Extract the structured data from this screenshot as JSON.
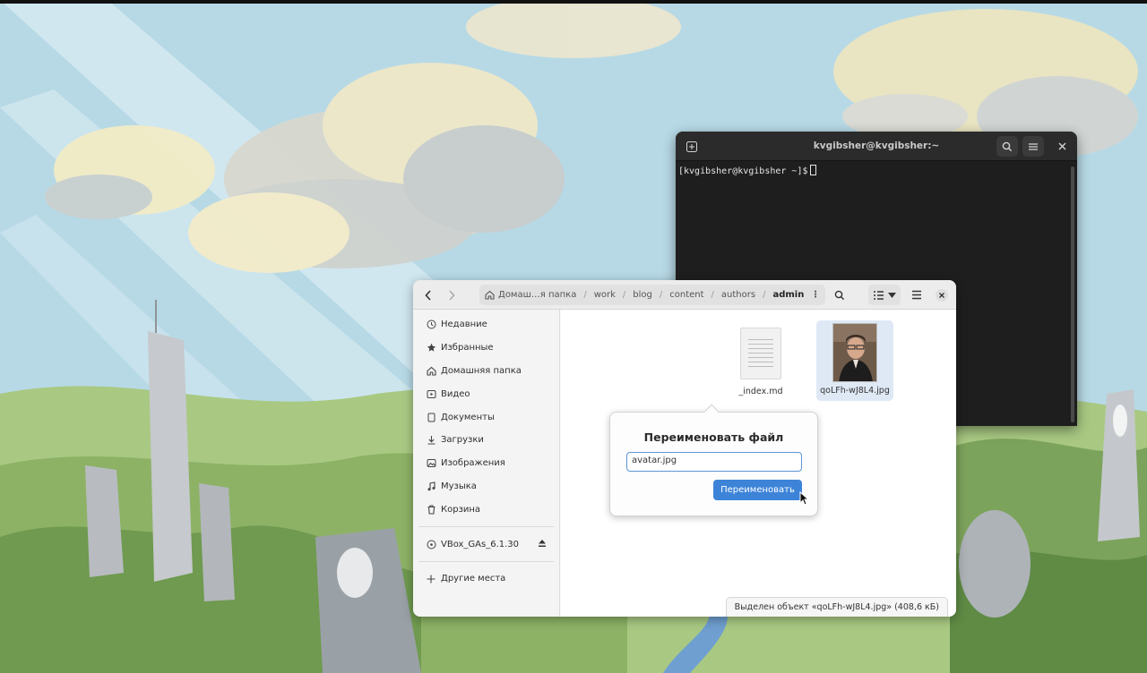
{
  "terminal": {
    "title": "kvgibsher@kvgibsher:~",
    "prompt": "[kvgibsher@kvgibsher ~]$"
  },
  "file_manager": {
    "breadcrumbs": [
      {
        "label": "Домаш…я папка",
        "icon": "home-icon"
      },
      {
        "label": "work"
      },
      {
        "label": "blog"
      },
      {
        "label": "content"
      },
      {
        "label": "authors"
      },
      {
        "label": "admin",
        "current": true
      }
    ],
    "sidebar": {
      "places": [
        {
          "label": "Недавние",
          "icon": "clock-icon"
        },
        {
          "label": "Избранные",
          "icon": "star-icon"
        },
        {
          "label": "Домашняя папка",
          "icon": "home-icon"
        },
        {
          "label": "Видео",
          "icon": "video-icon"
        },
        {
          "label": "Документы",
          "icon": "document-icon"
        },
        {
          "label": "Загрузки",
          "icon": "download-icon"
        },
        {
          "label": "Изображения",
          "icon": "image-icon"
        },
        {
          "label": "Музыка",
          "icon": "music-icon"
        },
        {
          "label": "Корзина",
          "icon": "trash-icon"
        }
      ],
      "devices": [
        {
          "label": "VBox_GAs_6.1.30",
          "icon": "disc-icon",
          "eject": true
        }
      ],
      "other": {
        "label": "Другие места",
        "icon": "plus-icon"
      }
    },
    "files": [
      {
        "name": "_index.md",
        "type": "document"
      },
      {
        "name": "qoLFh-wJ8L4.jpg",
        "type": "image",
        "selected": true
      }
    ],
    "status": "Выделен объект «qoLFh-wJ8L4.jpg» (408,6 кБ)"
  },
  "rename_dialog": {
    "title": "Переименовать файл",
    "value": "avatar.jpg",
    "button": "Переименовать"
  },
  "colors": {
    "accent": "#3d84d8",
    "selection": "#dfe9f5",
    "terminal_bg": "#1e1e1e"
  }
}
